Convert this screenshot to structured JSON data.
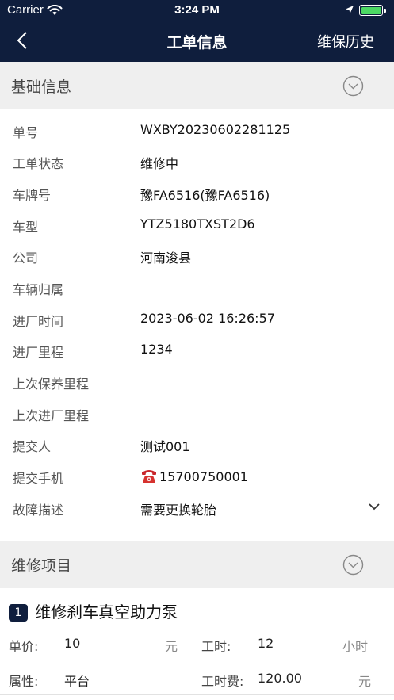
{
  "status_bar": {
    "carrier": "Carrier",
    "time": "3:24 PM"
  },
  "nav": {
    "title": "工单信息",
    "right_label": "维保历史"
  },
  "basic": {
    "header": "基础信息",
    "rows": [
      {
        "label": "单号",
        "value": "WXBY20230602281125"
      },
      {
        "label": "工单状态",
        "value": "维修中"
      },
      {
        "label": "车牌号",
        "value": "豫FA6516(豫FA6516)"
      },
      {
        "label": "车型",
        "value": "YTZ5180TXST2D6"
      },
      {
        "label": "公司",
        "value": "河南浚县"
      },
      {
        "label": "车辆归属",
        "value": ""
      },
      {
        "label": "进厂时间",
        "value": "2023-06-02 16:26:57"
      },
      {
        "label": "进厂里程",
        "value": "1234"
      },
      {
        "label": "上次保养里程",
        "value": ""
      },
      {
        "label": "上次进厂里程",
        "value": ""
      },
      {
        "label": "提交人",
        "value": "测试001"
      },
      {
        "label": "提交手机",
        "value": "15700750001"
      },
      {
        "label": "故障描述",
        "value": "需要更换轮胎"
      }
    ]
  },
  "repair": {
    "header": "维修项目",
    "item": {
      "index": "1",
      "name": "维修刹车真空助力泵",
      "unit_price_label": "单价:",
      "unit_price_value": "10",
      "unit_price_unit": "元",
      "hours_label": "工时:",
      "hours_value": "12",
      "hours_unit": "小时",
      "attr_label": "属性:",
      "attr_value": "平台",
      "fee_label": "工时费:",
      "fee_value": "120.00",
      "fee_unit": "元"
    }
  },
  "colors": {
    "nav_bg": "#0f1e3d",
    "section_bg": "#efefef",
    "battery": "#4cd964"
  }
}
